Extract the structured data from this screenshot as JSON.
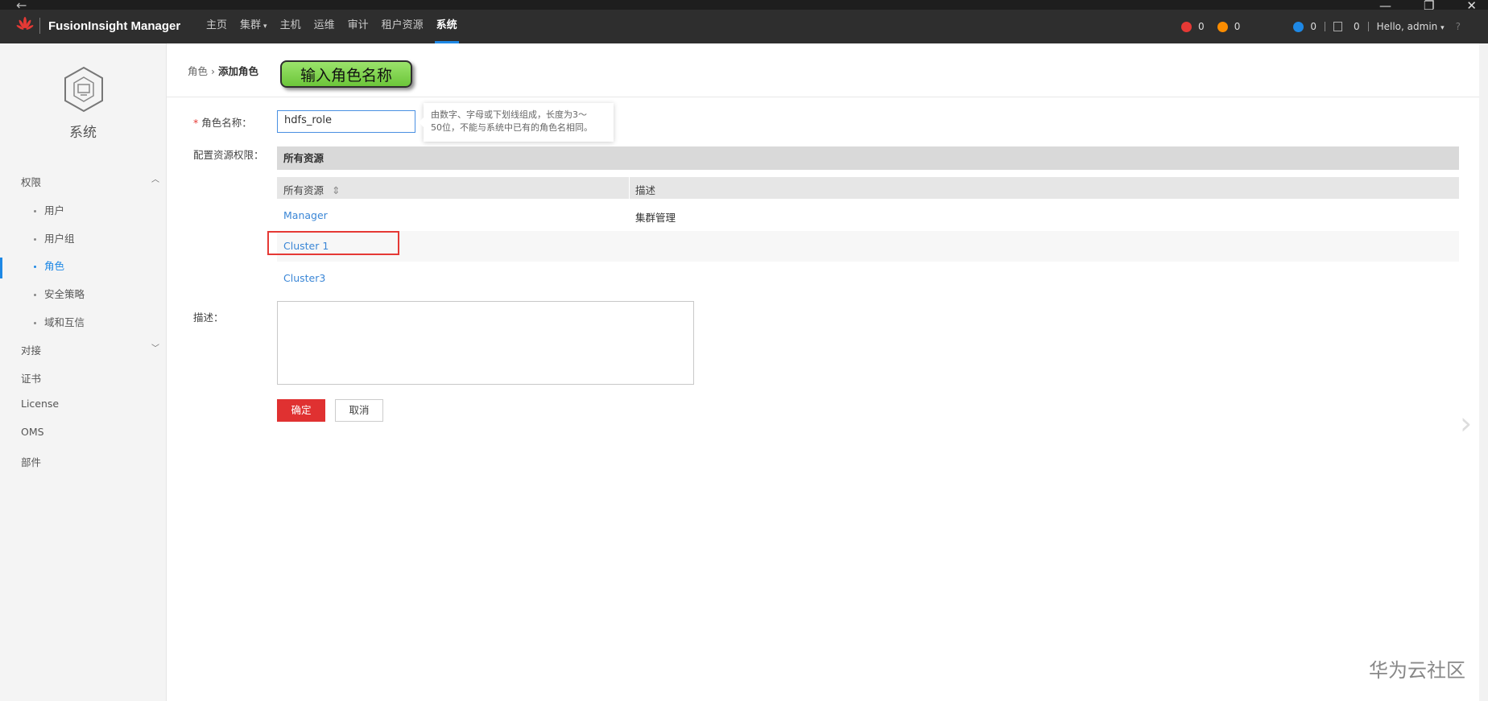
{
  "window": {
    "back_glyph": "←",
    "controls": [
      "—",
      "❐",
      "✕"
    ]
  },
  "header": {
    "app_title": "FusionInsight Manager",
    "nav": [
      {
        "label": "主页",
        "caret": ""
      },
      {
        "label": "集群",
        "caret": "▾"
      },
      {
        "label": "主机",
        "caret": ""
      },
      {
        "label": "运维",
        "caret": ""
      },
      {
        "label": "审计",
        "caret": ""
      },
      {
        "label": "租户资源",
        "caret": ""
      },
      {
        "label": "系统",
        "caret": ""
      }
    ],
    "active_nav": "系统",
    "status": {
      "critical_count": "0",
      "major_count": "0",
      "info_count": "0",
      "task_count": "0",
      "user_label": "Hello, admin",
      "user_caret": "▾",
      "help_glyph": "?"
    },
    "colors": {
      "critical": "#e53935",
      "major": "#fb8c00",
      "info": "#1e88e5"
    }
  },
  "sidebar": {
    "title": "系统",
    "sections": [
      {
        "label": "权限",
        "chevron": "︿"
      },
      {
        "label": "对接",
        "chevron": "﹀"
      },
      {
        "label": "证书"
      },
      {
        "label": "License"
      },
      {
        "label": "OMS"
      },
      {
        "label": "部件"
      }
    ],
    "sub_items": [
      {
        "label": "用户"
      },
      {
        "label": "用户组"
      },
      {
        "label": "角色"
      },
      {
        "label": "安全策略"
      },
      {
        "label": "域和互信"
      }
    ],
    "active_item": "角色"
  },
  "breadcrumb": {
    "parent": "角色",
    "separator": "›",
    "current": "添加角色"
  },
  "callout": "输入角色名称",
  "form": {
    "name_label": "角色名称：",
    "required_mark": "*",
    "name_value": "hdfs_role",
    "name_tooltip_line1": "由数字、字母或下划线组成，长度为3～",
    "name_tooltip_line2": "50位，不能与系统中已有的角色名相同。",
    "resource_label": "配置资源权限：",
    "resource_header": "所有资源",
    "columns": {
      "resource": "所有资源",
      "sort_glyph": "⇕",
      "description": "描述"
    },
    "rows": [
      {
        "resource": "Manager",
        "description": "集群管理"
      },
      {
        "resource": "Cluster 1",
        "description": ""
      },
      {
        "resource": "Cluster3",
        "description": ""
      }
    ],
    "desc_label": "描述：",
    "desc_value": "",
    "ok_label": "确定",
    "cancel_label": "取消"
  },
  "pager_glyph": "›",
  "watermark": "华为云社区"
}
